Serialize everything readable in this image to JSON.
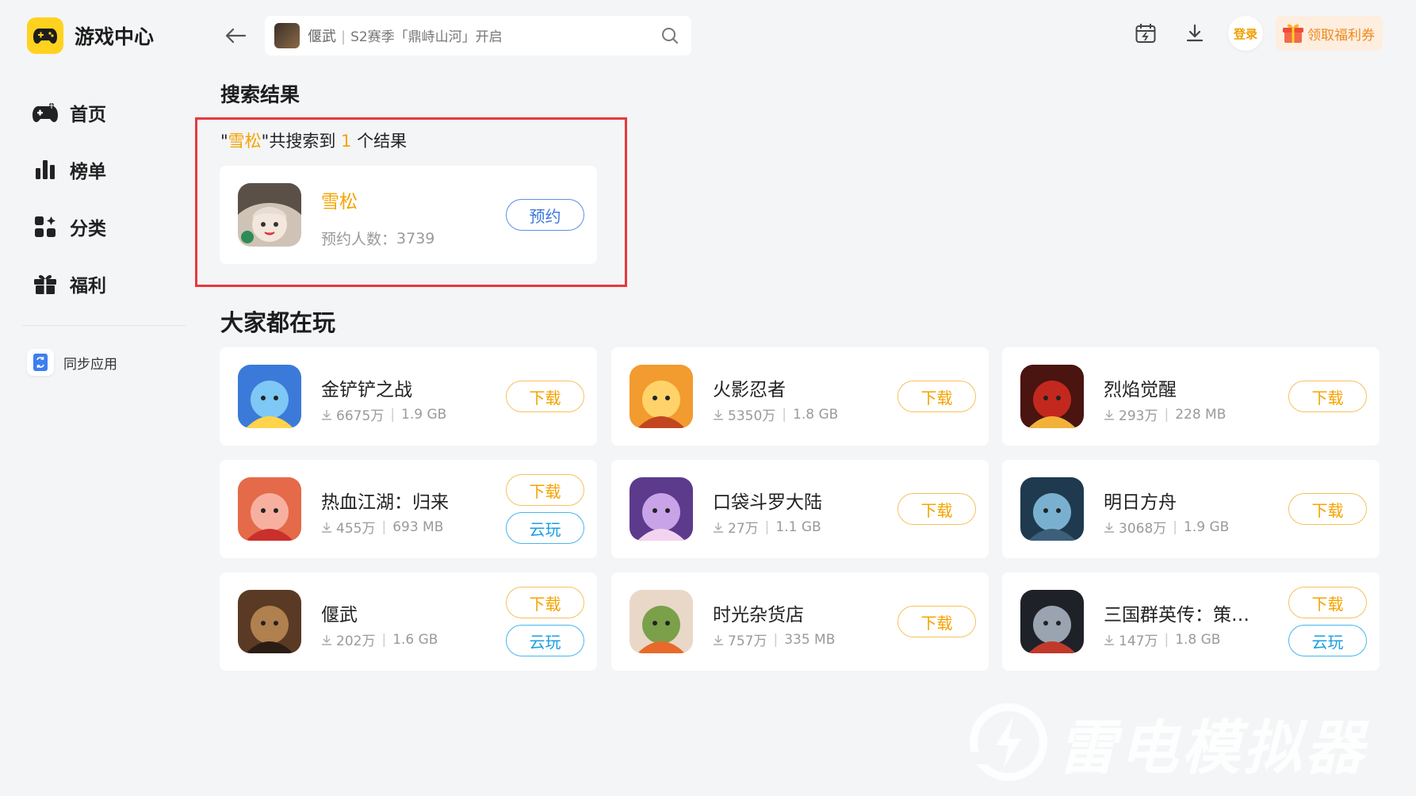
{
  "app": {
    "title": "游戏中心",
    "logo_icon": "gamepad-icon",
    "brand_color": "#ffd21f"
  },
  "sidebar": {
    "items": [
      {
        "label": "首页",
        "icon": "gamepad-icon"
      },
      {
        "label": "榜单",
        "icon": "bar-chart-icon"
      },
      {
        "label": "分类",
        "icon": "category-grid-icon"
      },
      {
        "label": "福利",
        "icon": "gift-icon"
      }
    ],
    "sync": {
      "label": "同步应用",
      "icon": "sync-app-icon"
    }
  },
  "search": {
    "game": "偃武",
    "divider": "|",
    "subtitle": "S2赛季「鼎峙山河」开启",
    "icon": "search-icon"
  },
  "topbar": {
    "login_label": "登录",
    "coupon_label": "领取福利券",
    "icons": [
      "calendar-icon",
      "download-icon",
      "gift-icon"
    ]
  },
  "results": {
    "heading": "搜索结果",
    "quote_open": "\"",
    "query": "雪松",
    "quote_close": "\"",
    "summary_pre": "共搜索到 ",
    "count": "1",
    "summary_post": " 个结果",
    "item": {
      "name": "雪松",
      "meta_label": "预约人数：",
      "meta_value": "3739",
      "button": "预约"
    }
  },
  "popular": {
    "heading": "大家都在玩",
    "sep": "|",
    "games": [
      {
        "name": "金铲铲之战",
        "downloads": "6675万",
        "size": "1.9 GB",
        "buttons": [
          "下载"
        ]
      },
      {
        "name": "火影忍者",
        "downloads": "5350万",
        "size": "1.8 GB",
        "buttons": [
          "下载"
        ]
      },
      {
        "name": "烈焰觉醒",
        "downloads": "293万",
        "size": "228 MB",
        "buttons": [
          "下载"
        ]
      },
      {
        "name": "热血江湖：归来",
        "downloads": "455万",
        "size": "693 MB",
        "buttons": [
          "下载",
          "云玩"
        ]
      },
      {
        "name": "口袋斗罗大陆",
        "downloads": "27万",
        "size": "1.1 GB",
        "buttons": [
          "下载"
        ]
      },
      {
        "name": "明日方舟",
        "downloads": "3068万",
        "size": "1.9 GB",
        "buttons": [
          "下载"
        ]
      },
      {
        "name": "偃武",
        "downloads": "202万",
        "size": "1.6 GB",
        "buttons": [
          "下载",
          "云玩"
        ]
      },
      {
        "name": "时光杂货店",
        "downloads": "757万",
        "size": "335 MB",
        "buttons": [
          "下载"
        ]
      },
      {
        "name": "三国群英传：策定…",
        "downloads": "147万",
        "size": "1.8 GB",
        "buttons": [
          "下载",
          "云玩"
        ]
      }
    ]
  },
  "watermark": {
    "text": "雷电模拟器"
  },
  "colors": {
    "accent": "#f5a300",
    "cloud": "#1a9de4",
    "highlight": "#e5393e",
    "reserve": "#3a78e0"
  }
}
